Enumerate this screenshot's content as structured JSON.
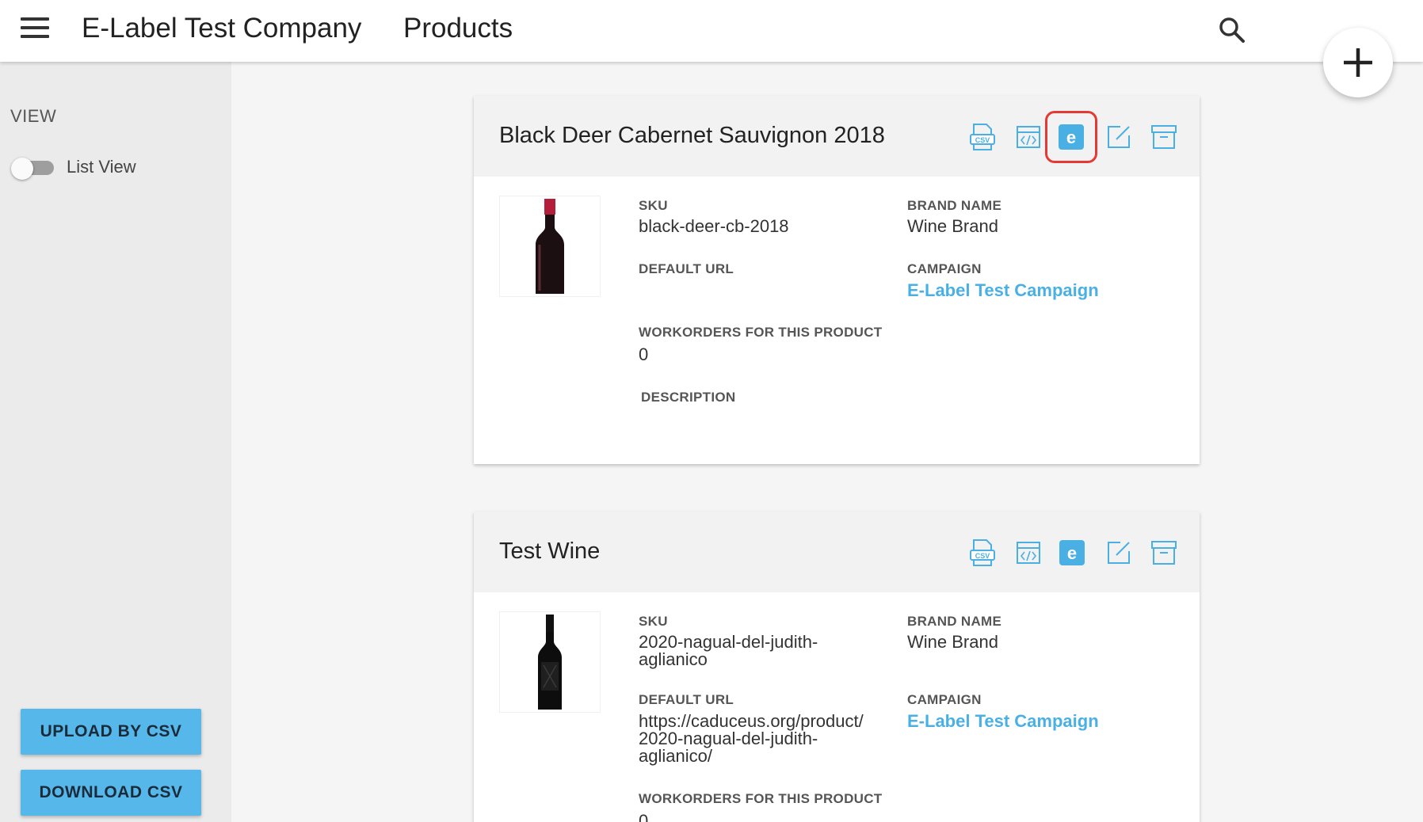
{
  "header": {
    "company": "E-Label Test Company",
    "section": "Products"
  },
  "sidebar": {
    "view_label": "VIEW",
    "toggle_label": "List View",
    "upload_button": "UPLOAD BY CSV",
    "download_button": "DOWNLOAD CSV"
  },
  "labels": {
    "sku": "SKU",
    "brand_name": "BRAND NAME",
    "default_url": "DEFAULT URL",
    "campaign": "CAMPAIGN",
    "workorders": "WORKORDERS FOR THIS PRODUCT",
    "description": "DESCRIPTION"
  },
  "action_icons": {
    "csv": "CSV",
    "elabel": "e"
  },
  "products": [
    {
      "title": "Black Deer Cabernet Sauvignon 2018",
      "sku": "black-deer-cb-2018",
      "brand": "Wine Brand",
      "default_url": "",
      "campaign": "E-Label Test Campaign",
      "workorders": "0"
    },
    {
      "title": "Test Wine",
      "sku_line1": "2020-nagual-del-judith-",
      "sku_line2": "aglianico",
      "brand": "Wine Brand",
      "url_line1": "https://caduceus.org/product/",
      "url_line2": "2020-nagual-del-judith-",
      "url_line3": "aglianico/",
      "campaign": "E-Label Test Campaign",
      "workorders": "0"
    }
  ],
  "colors": {
    "accent": "#56b8ea",
    "link": "#4ab0e4",
    "highlight": "#e53935"
  }
}
